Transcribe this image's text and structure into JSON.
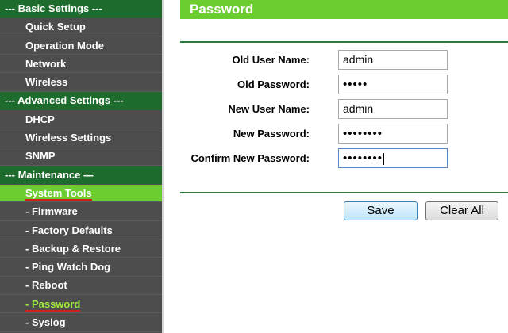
{
  "sidebar": {
    "items": [
      {
        "label": "--- Basic Settings ---",
        "kind": "section"
      },
      {
        "label": "Quick Setup",
        "kind": "item"
      },
      {
        "label": "Operation Mode",
        "kind": "item"
      },
      {
        "label": "Network",
        "kind": "item"
      },
      {
        "label": "Wireless",
        "kind": "item"
      },
      {
        "label": "--- Advanced Settings ---",
        "kind": "section"
      },
      {
        "label": "DHCP",
        "kind": "item"
      },
      {
        "label": "Wireless Settings",
        "kind": "item"
      },
      {
        "label": "SNMP",
        "kind": "item"
      },
      {
        "label": "--- Maintenance ---",
        "kind": "section"
      },
      {
        "label": "System Tools",
        "kind": "item",
        "state": "active"
      },
      {
        "label": "- Firmware",
        "kind": "item"
      },
      {
        "label": "- Factory Defaults",
        "kind": "item"
      },
      {
        "label": "- Backup & Restore",
        "kind": "item"
      },
      {
        "label": "- Ping Watch Dog",
        "kind": "item"
      },
      {
        "label": "- Reboot",
        "kind": "item"
      },
      {
        "label": "- Password",
        "kind": "item",
        "state": "current"
      },
      {
        "label": "- Syslog",
        "kind": "item"
      }
    ]
  },
  "page": {
    "title": "Password"
  },
  "form": {
    "old_user_name": {
      "label": "Old User Name:",
      "value": "admin"
    },
    "old_password": {
      "label": "Old Password:",
      "value": "•••••"
    },
    "new_user_name": {
      "label": "New User Name:",
      "value": "admin"
    },
    "new_password": {
      "label": "New Password:",
      "value": "••••••••"
    },
    "confirm_new_password": {
      "label": "Confirm New Password:",
      "value": "••••••••"
    }
  },
  "buttons": {
    "save": "Save",
    "clear_all": "Clear All"
  },
  "colors": {
    "header_green": "#6ccd31",
    "section_green": "#1e6b2e",
    "sidebar_gray": "#4d4d4d",
    "current_link_green": "#9eea3f",
    "underline_red": "#d2201b"
  }
}
